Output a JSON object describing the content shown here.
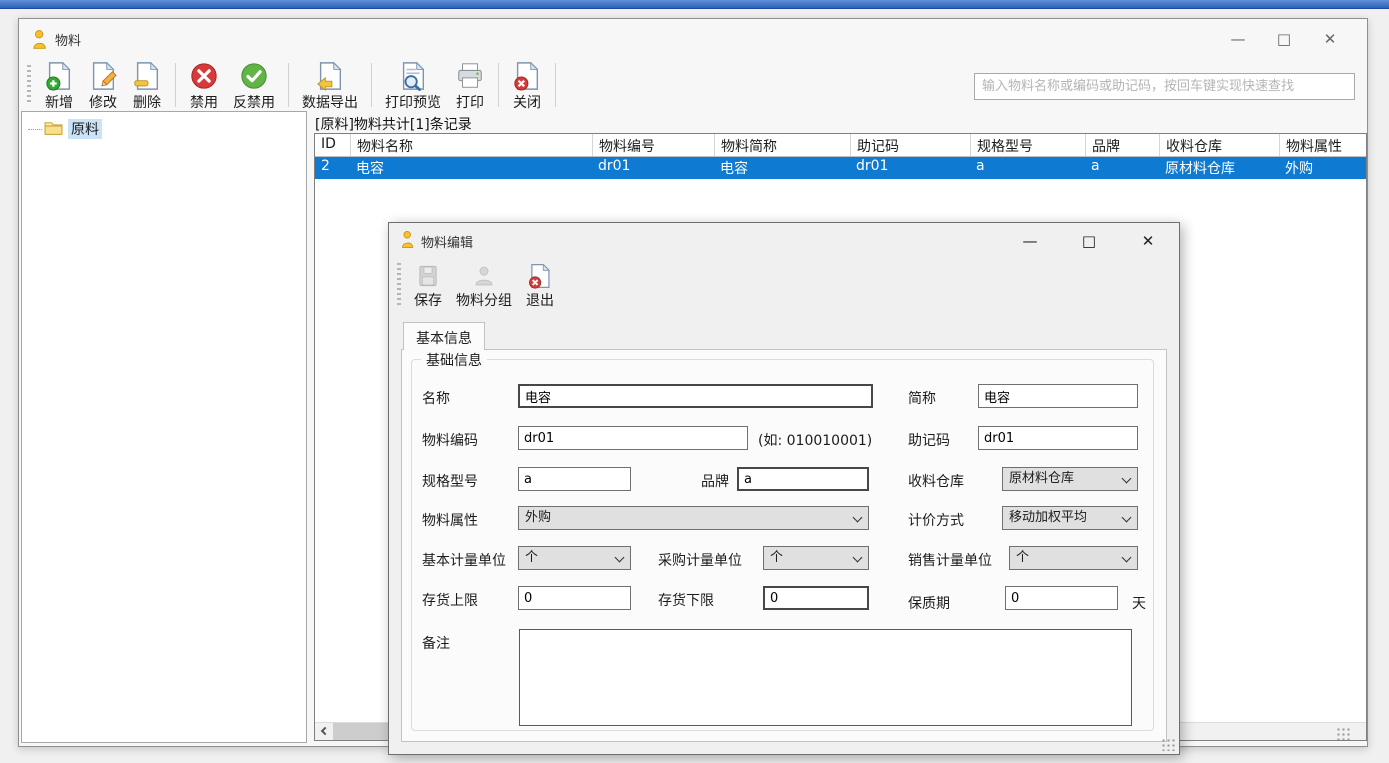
{
  "colors": {
    "selection_blue": "#0f7ad2",
    "top_strip": "#2e62b8",
    "folder_yellow": "#f7df8b"
  },
  "main_window": {
    "title": "物料",
    "window_controls": {
      "minimize": "—",
      "maximize": "□",
      "close": "✕"
    },
    "toolbar": {
      "buttons": [
        {
          "label": "新增",
          "icon": "doc-plus-icon"
        },
        {
          "label": "修改",
          "icon": "doc-pencil-icon"
        },
        {
          "label": "删除",
          "icon": "doc-minus-icon"
        },
        {
          "label": "禁用",
          "icon": "ban-icon"
        },
        {
          "label": "反禁用",
          "icon": "check-circle-icon"
        },
        {
          "label": "数据导出",
          "icon": "doc-export-icon"
        },
        {
          "label": "打印预览",
          "icon": "print-preview-icon"
        },
        {
          "label": "打印",
          "icon": "printer-icon"
        },
        {
          "label": "关闭",
          "icon": "doc-close-icon"
        }
      ]
    },
    "search": {
      "placeholder": "输入物料名称或编码或助记码，按回车键实现快速查找",
      "value": ""
    },
    "tree": {
      "root": {
        "label": "原料"
      }
    },
    "list_caption": "[原料]物料共计[1]条记录",
    "table": {
      "columns": [
        "ID",
        "物料名称",
        "物料编号",
        "物料简称",
        "助记码",
        "规格型号",
        "品牌",
        "收料仓库",
        "物料属性"
      ],
      "rows": [
        [
          "2",
          "电容",
          "dr01",
          "电容",
          "dr01",
          "a",
          "a",
          "原材料仓库",
          "外购"
        ]
      ]
    }
  },
  "dialog": {
    "title": "物料编辑",
    "window_controls": {
      "minimize": "—",
      "maximize": "□",
      "close": "✕"
    },
    "toolbar": {
      "save": "保存",
      "material_group": "物料分组",
      "exit": "退出"
    },
    "tab_label": "基本信息",
    "groupbox_label": "基础信息",
    "fields": {
      "name": {
        "label": "名称",
        "value": "电容"
      },
      "short_name": {
        "label": "简称",
        "value": "电容"
      },
      "material_code": {
        "label": "物料编码",
        "value": "dr01",
        "hint": "(如: 010010001)"
      },
      "mnemonic_code": {
        "label": "助记码",
        "value": "dr01"
      },
      "spec_model": {
        "label": "规格型号",
        "value": "a"
      },
      "brand": {
        "label": "品牌",
        "value": "a"
      },
      "receiving_warehouse": {
        "label": "收料仓库",
        "value": "原材料仓库"
      },
      "material_attribute": {
        "label": "物料属性",
        "value": "外购"
      },
      "pricing_method": {
        "label": "计价方式",
        "value": "移动加权平均"
      },
      "base_unit": {
        "label": "基本计量单位",
        "value": "个"
      },
      "purchase_unit": {
        "label": "采购计量单位",
        "value": "个"
      },
      "sales_unit": {
        "label": "销售计量单位",
        "value": "个"
      },
      "stock_upper_limit": {
        "label": "存货上限",
        "value": "0"
      },
      "stock_lower_limit": {
        "label": "存货下限",
        "value": "0"
      },
      "shelf_life": {
        "label": "保质期",
        "value": "0",
        "unit": "天"
      },
      "remark": {
        "label": "备注",
        "value": ""
      }
    }
  }
}
